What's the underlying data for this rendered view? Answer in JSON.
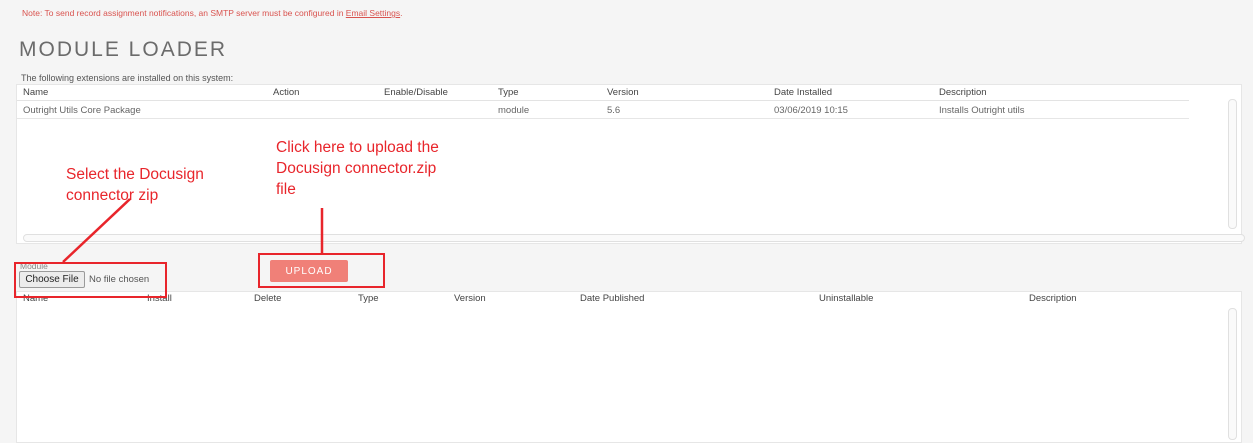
{
  "note": {
    "text": "Note: To send record assignment notifications, an SMTP server must be configured in ",
    "link": "Email Settings",
    "end": "."
  },
  "page_title": "MODULE LOADER",
  "installed": {
    "intro": "The following extensions are installed on this system:",
    "columns": {
      "name": "Name",
      "action": "Action",
      "enable": "Enable/Disable",
      "type": "Type",
      "version": "Version",
      "date": "Date Installed",
      "description": "Description"
    },
    "rows": [
      {
        "name": "Outright Utils Core Package",
        "type": "module",
        "version": "5.6",
        "date": "03/06/2019 10:15",
        "description": "Installs Outright utils"
      }
    ]
  },
  "upload": {
    "module_label": "Module",
    "choose_file_label": "Choose File",
    "no_file_text": "No file chosen",
    "upload_label": "UPLOAD",
    "columns": {
      "name": "Name",
      "install": "Install",
      "delete": "Delete",
      "type": "Type",
      "version": "Version",
      "date": "Date Published",
      "uninstallable": "Uninstallable",
      "description": "Description"
    }
  },
  "annotations": {
    "select_zip": [
      "Select the Docusign",
      "connector zip"
    ],
    "upload_zip": [
      "Click here to upload the",
      "Docusign connector.zip",
      "file"
    ],
    "color": "#e8252b"
  },
  "colors": {
    "note": "#d9534f",
    "upload_button": "#f08078",
    "panel_background": "#ffffff",
    "page_background": "#f5f5f5"
  }
}
